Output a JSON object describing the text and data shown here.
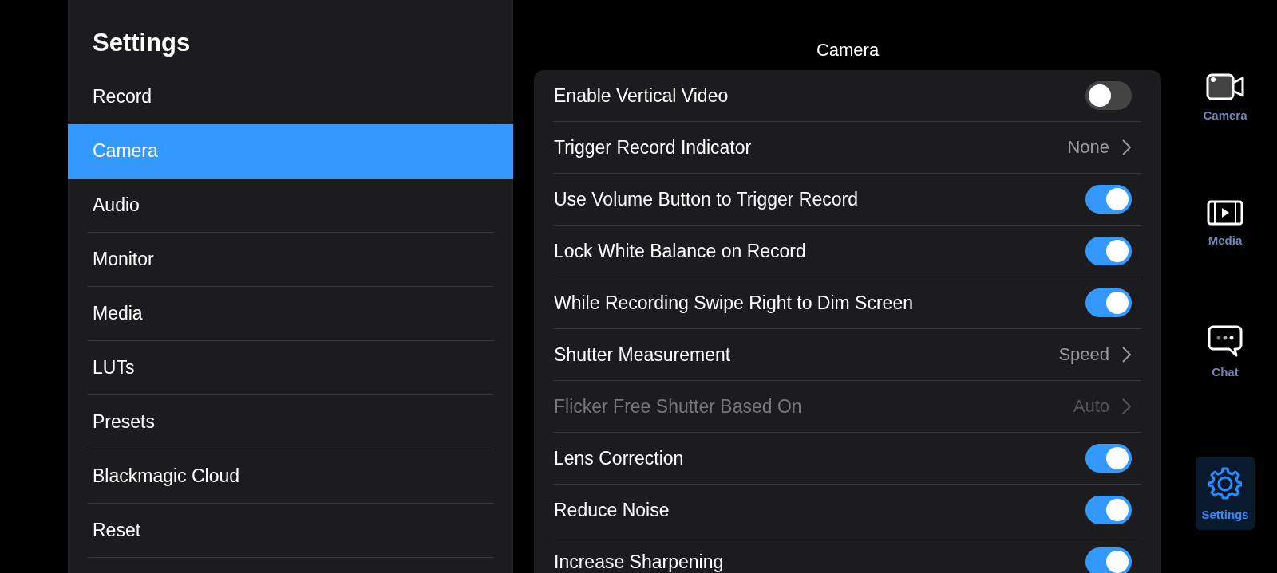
{
  "sidebar": {
    "title": "Settings",
    "items": [
      {
        "label": "Record",
        "selected": false
      },
      {
        "label": "Camera",
        "selected": true
      },
      {
        "label": "Audio",
        "selected": false
      },
      {
        "label": "Monitor",
        "selected": false
      },
      {
        "label": "Media",
        "selected": false
      },
      {
        "label": "LUTs",
        "selected": false
      },
      {
        "label": "Presets",
        "selected": false
      },
      {
        "label": "Blackmagic Cloud",
        "selected": false
      },
      {
        "label": "Reset",
        "selected": false
      }
    ]
  },
  "main": {
    "title": "Camera",
    "rows": [
      {
        "kind": "toggle",
        "label": "Enable Vertical Video",
        "on": false,
        "disabled": false
      },
      {
        "kind": "link",
        "label": "Trigger Record Indicator",
        "value": "None",
        "disabled": false
      },
      {
        "kind": "toggle",
        "label": "Use Volume Button to Trigger Record",
        "on": true,
        "disabled": false
      },
      {
        "kind": "toggle",
        "label": "Lock White Balance on Record",
        "on": true,
        "disabled": false
      },
      {
        "kind": "toggle",
        "label": "While Recording Swipe Right to Dim Screen",
        "on": true,
        "disabled": false
      },
      {
        "kind": "link",
        "label": "Shutter Measurement",
        "value": "Speed",
        "disabled": false
      },
      {
        "kind": "link",
        "label": "Flicker Free Shutter Based On",
        "value": "Auto",
        "disabled": true
      },
      {
        "kind": "toggle",
        "label": "Lens Correction",
        "on": true,
        "disabled": false
      },
      {
        "kind": "toggle",
        "label": "Reduce Noise",
        "on": true,
        "disabled": false
      },
      {
        "kind": "toggle",
        "label": "Increase Sharpening",
        "on": true,
        "disabled": false
      }
    ]
  },
  "nav": [
    {
      "kind": "camera",
      "label": "Camera",
      "selected": false
    },
    {
      "kind": "media",
      "label": "Media",
      "selected": false
    },
    {
      "kind": "chat",
      "label": "Chat",
      "selected": false
    },
    {
      "kind": "settings",
      "label": "Settings",
      "selected": true
    }
  ]
}
